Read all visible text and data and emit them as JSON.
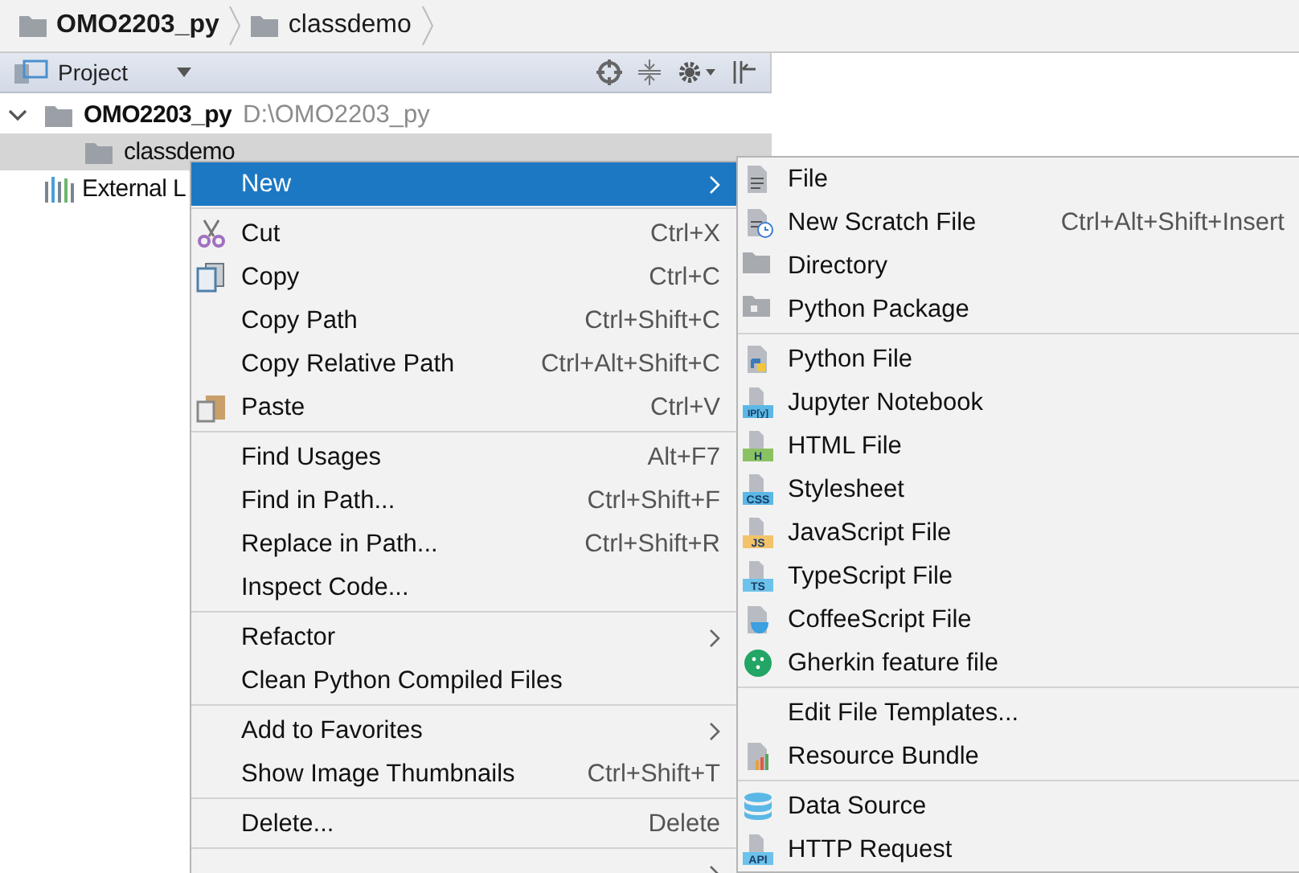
{
  "breadcrumbs": [
    {
      "label": "OMO2203_py",
      "bold": true
    },
    {
      "label": "classdemo",
      "bold": false
    }
  ],
  "project_panel": {
    "title": "Project"
  },
  "tree": [
    {
      "label": "OMO2203_py",
      "path": "D:\\OMO2203_py",
      "expanded": true,
      "selected": false,
      "children": [
        {
          "label": "classdemo",
          "selected": true
        }
      ]
    },
    {
      "label": "External L",
      "selected": false
    }
  ],
  "context_menu": {
    "groups": [
      [
        {
          "label": "New",
          "selected": true,
          "has_submenu": true
        }
      ],
      [
        {
          "label": "Cut",
          "shortcut": "Ctrl+X",
          "selected": false
        },
        {
          "label": "Copy",
          "shortcut": "Ctrl+C",
          "selected": false
        },
        {
          "label": "Copy Path",
          "shortcut": "Ctrl+Shift+C",
          "selected": false
        },
        {
          "label": "Copy Relative Path",
          "shortcut": "Ctrl+Alt+Shift+C",
          "selected": false
        },
        {
          "label": "Paste",
          "shortcut": "Ctrl+V",
          "selected": false
        }
      ],
      [
        {
          "label": "Find Usages",
          "shortcut": "Alt+F7",
          "selected": false
        },
        {
          "label": "Find in Path...",
          "shortcut": "Ctrl+Shift+F",
          "selected": false
        },
        {
          "label": "Replace in Path...",
          "shortcut": "Ctrl+Shift+R",
          "selected": false
        },
        {
          "label": "Inspect Code...",
          "selected": false
        }
      ],
      [
        {
          "label": "Refactor",
          "selected": false,
          "has_submenu": true
        },
        {
          "label": "Clean Python Compiled Files",
          "selected": false
        }
      ],
      [
        {
          "label": "Add to Favorites",
          "selected": false,
          "has_submenu": true
        },
        {
          "label": "Show Image Thumbnails",
          "shortcut": "Ctrl+Shift+T",
          "selected": false
        }
      ],
      [
        {
          "label": "Delete...",
          "shortcut": "Delete",
          "selected": false
        }
      ],
      [
        {
          "selected": false,
          "has_submenu": true
        }
      ]
    ]
  },
  "submenu": {
    "groups": [
      [
        {
          "label": "File"
        },
        {
          "label": "New Scratch File",
          "shortcut": "Ctrl+Alt+Shift+Insert"
        },
        {
          "label": "Directory"
        },
        {
          "label": "Python Package"
        }
      ],
      [
        {
          "label": "Python File"
        },
        {
          "label": "Jupyter Notebook",
          "icon_label": "IP[y]"
        },
        {
          "label": "HTML File",
          "icon_label": "H"
        },
        {
          "label": "Stylesheet",
          "icon_label": "CSS"
        },
        {
          "label": "JavaScript File",
          "icon_label": "JS"
        },
        {
          "label": "TypeScript File",
          "icon_label": "TS"
        },
        {
          "label": "CoffeeScript File"
        },
        {
          "label": "Gherkin feature file"
        }
      ],
      [
        {
          "label": "Edit File Templates..."
        },
        {
          "label": "Resource Bundle"
        }
      ],
      [
        {
          "label": "Data Source"
        },
        {
          "label": "HTTP Request",
          "icon_label": "API"
        }
      ]
    ]
  }
}
